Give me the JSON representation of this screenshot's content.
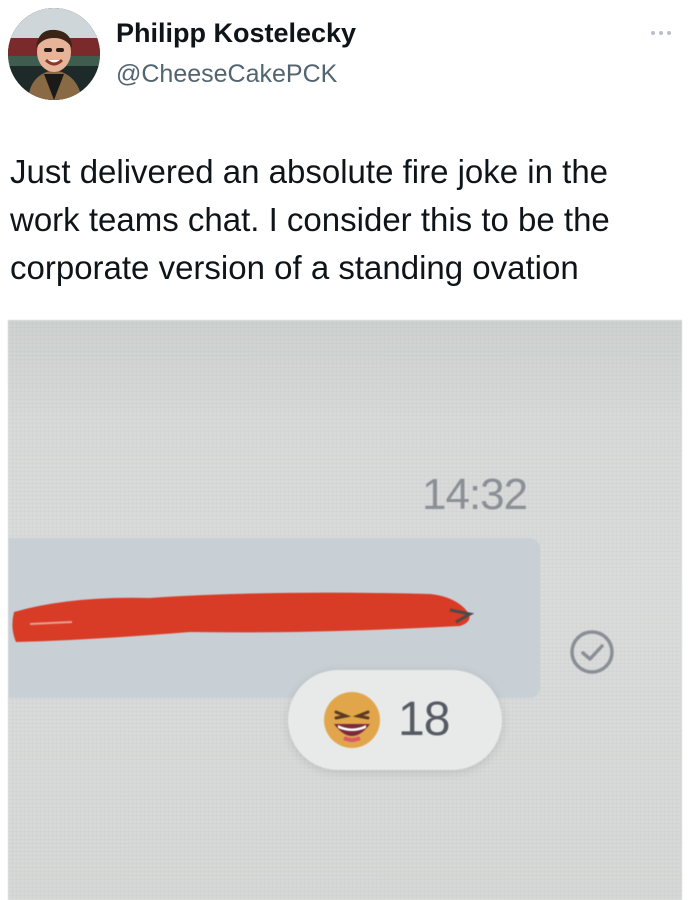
{
  "tweet": {
    "author": {
      "display_name": "Philipp Kostelecky",
      "handle": "@CheeseCakePCK",
      "avatar_icon": "profile-photo"
    },
    "more_icon": "more-horizontal-icon",
    "text_lines": [
      "Just delivered an absolute fire joke in the",
      "work teams chat. I consider this to be the",
      "corporate version of a standing ovation"
    ]
  },
  "screenshot": {
    "message_time": "14:32",
    "message_text": "[redacted]",
    "redaction_color": "#d83b26",
    "read_receipt_icon": "check-circle-icon",
    "reaction": {
      "emoji": "laughing-emoji",
      "count": "18"
    }
  }
}
